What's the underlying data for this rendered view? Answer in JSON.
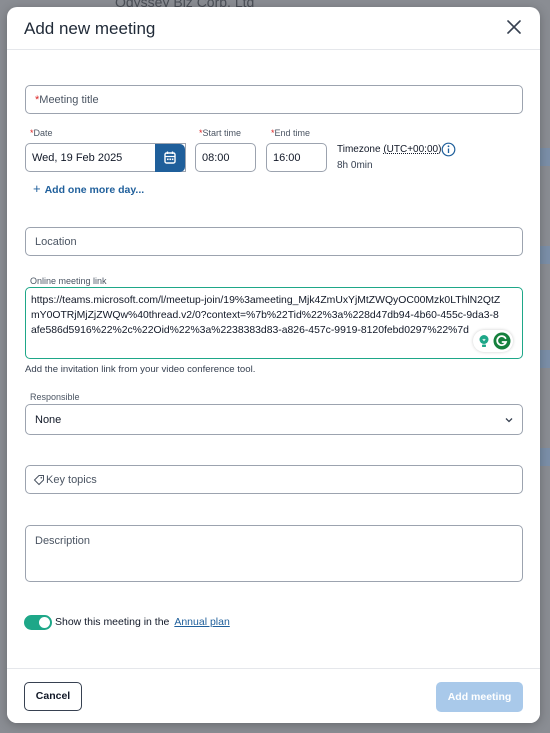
{
  "background": {
    "company": "Odyssey Biz Corp. Ltd"
  },
  "dialog": {
    "title": "Add new meeting"
  },
  "form": {
    "meeting_title": {
      "required_mark": "*",
      "placeholder": "Meeting title"
    },
    "date": {
      "required_mark": "*",
      "label": "Date",
      "value": "Wed, 19 Feb 2025"
    },
    "start_time": {
      "required_mark": "*",
      "label": "Start time",
      "value": "08:00"
    },
    "end_time": {
      "required_mark": "*",
      "label": "End time",
      "value": "16:00"
    },
    "timezone": {
      "label": "Timezone",
      "value": "(UTC+00:00)",
      "duration": "8h 0min"
    },
    "add_day": "Add one more day...",
    "location": {
      "placeholder": "Location"
    },
    "online_link": {
      "label": "Online meeting link",
      "value": "https://teams.microsoft.com/l/meetup-join/19%3ameeting_Mjk4ZmUxYjMtZWQyOC00Mzk0LThlN2QtZmY0OTRjMjZjZWQw%40thread.v2/0?context=%7b%22Tid%22%3a%228d47db94-4b60-455c-9da3-8afe586d5916%22%2c%22Oid%22%3a%2238383d83-a826-457c-9919-8120febd0297%22%7d",
      "hint": "Add the invitation link from your video conference tool."
    },
    "responsible": {
      "label": "Responsible",
      "value": "None"
    },
    "key_topics": {
      "placeholder": "Key topics"
    },
    "description": {
      "placeholder": "Description"
    },
    "annual_plan": {
      "text": "Show this meeting in the",
      "link": "Annual plan",
      "enabled": true
    }
  },
  "footer": {
    "cancel": "Cancel",
    "submit": "Add meeting"
  },
  "colors": {
    "accent": "#1ea788",
    "primary": "#1f5f9b",
    "disabled": "#a9c9ea"
  }
}
